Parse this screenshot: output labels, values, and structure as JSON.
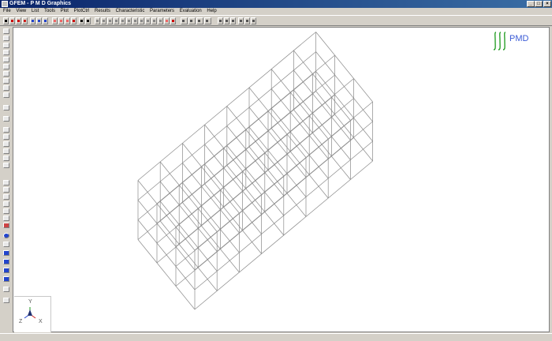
{
  "window": {
    "title": "GFEM - P M D Graphics"
  },
  "menu": [
    "File",
    "View",
    "List",
    "Tools",
    "Plot",
    "PlotCtrl",
    "Results",
    "Characteristic",
    "Parameters",
    "Evaluation",
    "Help"
  ],
  "logo": {
    "text": "PMD",
    "color": "#2aa02a",
    "text_color": "#3b5bd6"
  },
  "axes": {
    "y": "Y",
    "z": "Z",
    "x": "X"
  },
  "colors": {
    "titlebar": "#0a246a",
    "mesh": "#8a8a8a",
    "toolbar_bg": "#d4d0c8"
  },
  "mesh": {
    "front_bottom": [
      [
        174,
        302
      ],
      [
        242,
        390
      ],
      [
        246,
        391
      ]
    ],
    "nodes": "wireframe box mesh 8x3x3 elements"
  }
}
